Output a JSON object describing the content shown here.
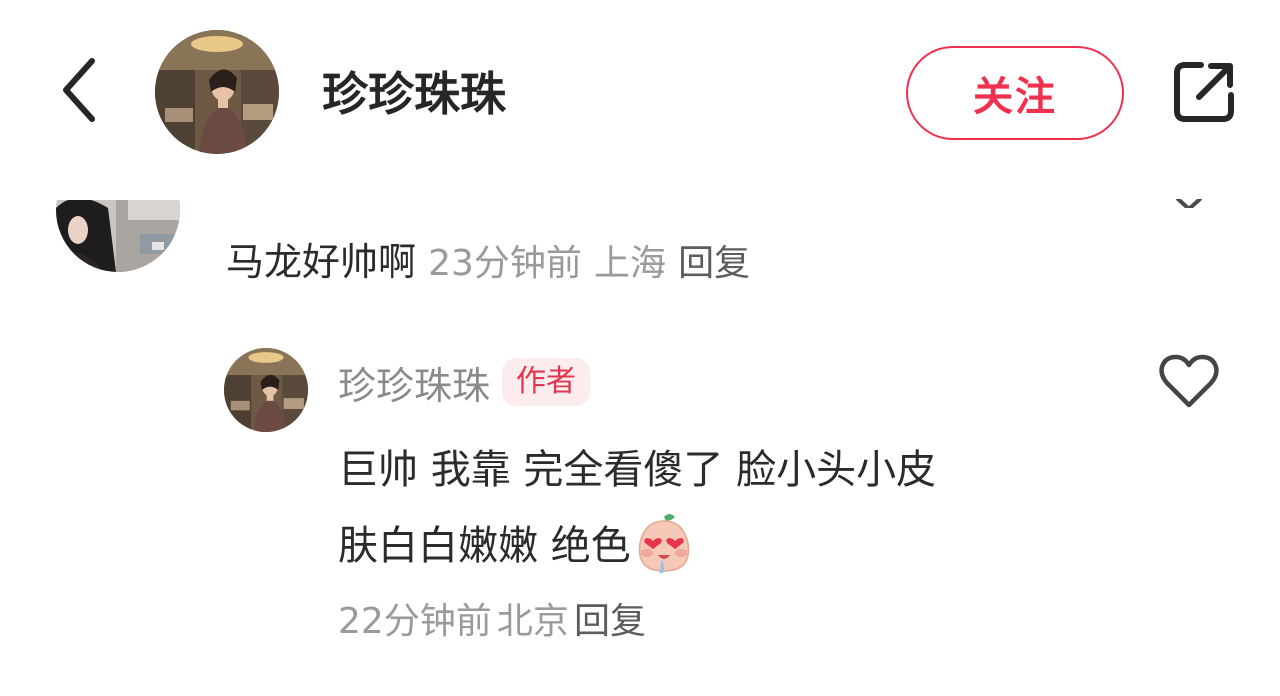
{
  "header": {
    "back_icon": "chevron-left-icon",
    "avatar_icon": "user-avatar-photo",
    "username": "珍珍珠珠",
    "follow_label": "关注",
    "share_icon": "share-external-icon",
    "accent_color": "#f0304f"
  },
  "comments": [
    {
      "avatar_icon": "user-avatar-photo",
      "text": "马龙好帅啊",
      "time": "23分钟前",
      "location": "上海",
      "reply_label": "回复"
    },
    {
      "avatar_icon": "user-avatar-photo",
      "username": "珍珍珠珠",
      "author_tag": "作者",
      "text_line1": "巨帅 我靠 完全看傻了 脸小头小皮",
      "text_line2": "肤白白嫩嫩 绝色",
      "emoji_icon": "heart-eyes-drool-emoji",
      "time": "22分钟前",
      "location": "北京",
      "reply_label": "回复",
      "like_icon": "heart-outline-icon"
    }
  ]
}
